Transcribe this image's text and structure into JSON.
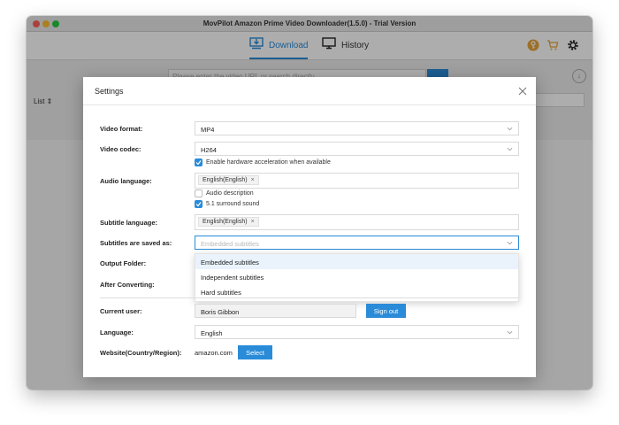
{
  "window": {
    "title": "MovPilot Amazon Prime Video Downloader(1.5.0) - Trial Version"
  },
  "nav": {
    "download_label": "Download",
    "history_label": "History"
  },
  "toolbar": {
    "url_placeholder": "Please enter the video URL or search directly",
    "list_label": "List"
  },
  "colors": {
    "accent": "#2a8bd8",
    "key_icon": "#e8a43a",
    "cart_icon": "#e8a43a"
  },
  "settings": {
    "title": "Settings",
    "video_format": {
      "label": "Video format:",
      "value": "MP4"
    },
    "video_codec": {
      "label": "Video codec:",
      "value": "H264",
      "hw_accel_label": "Enable hardware acceleration when available",
      "hw_accel_checked": true
    },
    "audio_language": {
      "label": "Audio language:",
      "tag": "English(English)",
      "audio_description_label": "Audio description",
      "audio_description_checked": false,
      "surround_label": "5.1 surround sound",
      "surround_checked": true
    },
    "subtitle_language": {
      "label": "Subtitle language:",
      "tag": "English(English)"
    },
    "subtitles_saved_as": {
      "label": "Subtitles are saved as:",
      "placeholder": "Embedded subtitles",
      "options": [
        "Embedded subtitles",
        "Independent subtitles",
        "Hard subtitles"
      ],
      "highlighted": "Embedded subtitles"
    },
    "output_folder": {
      "label": "Output Folder:"
    },
    "after_converting": {
      "label": "After Converting:"
    },
    "current_user": {
      "label": "Current user:",
      "value": "Boris Gibbon",
      "sign_out_label": "Sign out"
    },
    "language": {
      "label": "Language:",
      "value": "English"
    },
    "website": {
      "label": "Website(Country/Region):",
      "value": "amazon.com",
      "select_label": "Select"
    }
  }
}
